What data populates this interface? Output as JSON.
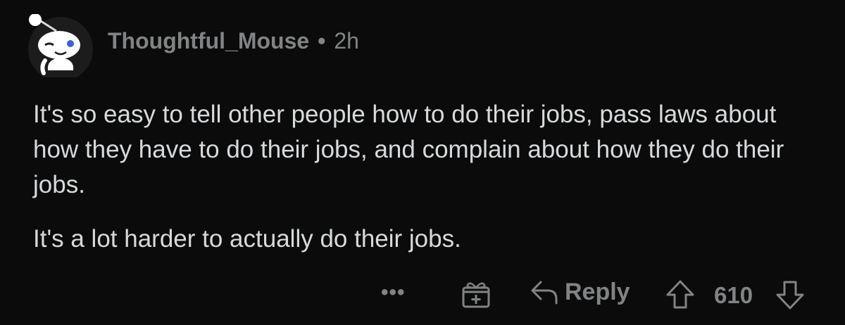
{
  "comment": {
    "author": "Thoughtful_Mouse",
    "separator": "•",
    "age": "2h",
    "paragraphs": [
      "It's so easy to tell other people how to do their jobs, pass laws about how they have to do their jobs, and complain about how they do their jobs.",
      "It's a lot harder to actually do their jobs."
    ]
  },
  "actions": {
    "more_label": "•••",
    "reply_label": "Reply",
    "score": "610"
  },
  "icons": {
    "avatar": "snoo-avatar-icon",
    "more": "more-options-icon",
    "award": "gift-award-icon",
    "reply": "reply-arrow-icon",
    "upvote": "upvote-arrow-icon",
    "downvote": "downvote-arrow-icon"
  },
  "colors": {
    "background": "#0b0b0b",
    "text": "#d7dadc",
    "muted": "#818384"
  }
}
